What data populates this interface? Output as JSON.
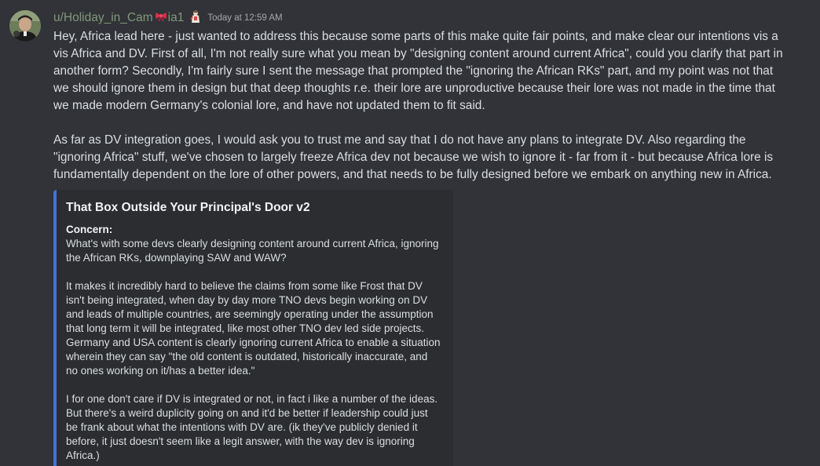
{
  "message": {
    "username": "u/Holiday_in_Cam",
    "username_suffix": "ia1",
    "timestamp": "Today at 12:59 AM",
    "icons": {
      "avatar": "avatar-image",
      "bow": "red-bow-icon",
      "badge": "figure-badge-icon"
    },
    "colors": {
      "username": "#80987a",
      "embed_accent": "#3f74d5",
      "background": "#313338"
    },
    "paragraphs": [
      "Hey, Africa lead here - just wanted to address this because some parts of this make quite fair points, and make clear our intentions vis a vis Africa and DV. First of all, I'm not really sure what you mean by \"designing content around current Africa\", could you clarify that part in another form? Secondly, I'm fairly sure I sent the message that prompted the \"ignoring the African RKs\" part, and my point was not that we should ignore them in design but that deep thoughts r.e. their lore are unproductive because their lore was not made in the time that we made modern Germany's colonial lore, and have not updated them to fit said.",
      "As far as DV integration goes, I would ask you to trust me and say that I do not have any plans to integrate DV. Also regarding the \"ignoring Africa\" stuff, we've chosen to largely freeze Africa dev not because we wish to ignore it - far from it - but because Africa lore is fundamentally dependent on the lore of other powers, and that needs to be fully designed before we embark on anything new in Africa."
    ]
  },
  "embed": {
    "title": "That Box Outside Your Principal's Door v2",
    "field_name": "Concern:",
    "field_paragraphs": [
      "What's with some devs clearly designing content around current Africa, ignoring the African RKs, downplaying SAW and WAW?",
      "It makes it incredibly hard to believe the claims from some like Frost that DV isn't being integrated, when day by day more TNO devs begin working on DV and leads of multiple countries, are seemingly operating under the assumption that long term it will be integrated, like most other TNO dev led side projects. Germany and USA content is clearly ignoring current Africa to enable a situation wherein they can say \"the old content is outdated, historically inaccurate, and no ones working on it/has a better idea.\"",
      "I for one don't care if DV is integrated or not, in fact i like a number of the ideas. But there's a weird duplicity going on and it'd be better if leadership could just be frank about what the intentions with DV are. (ik they've publicly denied it before, it just doesn't seem like a legit answer, with the way dev is ignoring Africa.)"
    ]
  }
}
